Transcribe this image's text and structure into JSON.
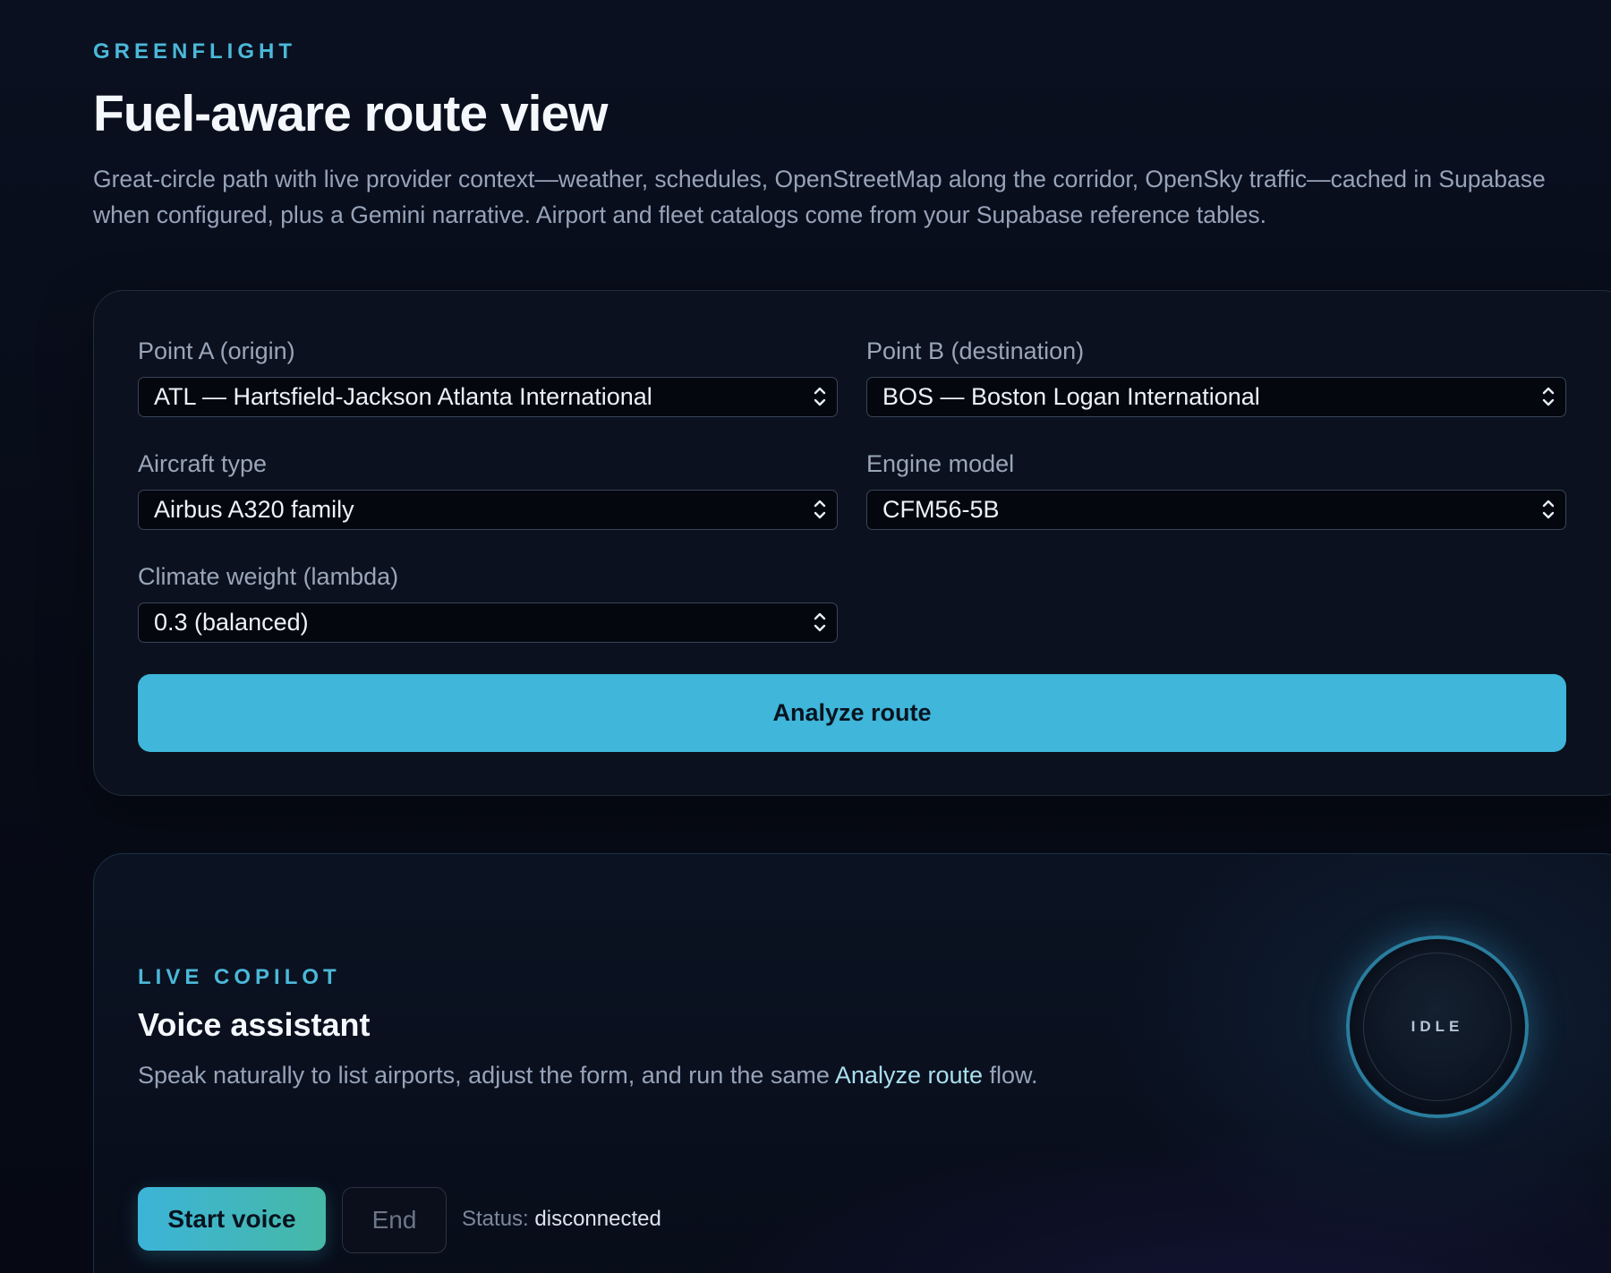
{
  "header": {
    "eyebrow": "GREENFLIGHT",
    "title": "Fuel-aware route view",
    "description": "Great-circle path with live provider context—weather, schedules, OpenStreetMap along the corridor, OpenSky traffic—cached in Supabase when configured, plus a Gemini narrative. Airport and fleet catalogs come from your Supabase reference tables."
  },
  "form": {
    "origin": {
      "label": "Point A (origin)",
      "value": "ATL — Hartsfield-Jackson Atlanta International"
    },
    "destination": {
      "label": "Point B (destination)",
      "value": "BOS — Boston Logan International"
    },
    "aircraft": {
      "label": "Aircraft type",
      "value": "Airbus A320 family"
    },
    "engine": {
      "label": "Engine model",
      "value": "CFM56-5B"
    },
    "climate": {
      "label": "Climate weight (lambda)",
      "value": "0.3 (balanced)"
    },
    "analyze_label": "Analyze route"
  },
  "copilot": {
    "eyebrow": "LIVE COPILOT",
    "title": "Voice assistant",
    "desc_before": "Speak naturally to list airports, adjust the form, and run the same ",
    "desc_highlight": "Analyze route",
    "desc_after": " flow.",
    "orb_state": "IDLE",
    "start_label": "Start voice",
    "end_label": "End",
    "status_label": "Status:",
    "status_value": "disconnected"
  },
  "colors": {
    "accent": "#3fb6da",
    "background": "#070b16"
  }
}
